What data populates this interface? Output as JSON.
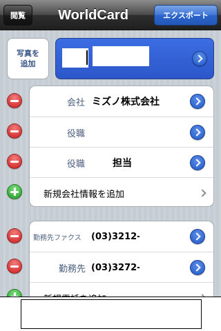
{
  "navbar": {
    "left_button": "閲覧",
    "title": "WorldCard",
    "right_button": "エクスポート"
  },
  "photo": {
    "label_line1": "写真を",
    "label_line2": "追加"
  },
  "company_section": {
    "rows": [
      {
        "label": "会社",
        "value": "ミズノ株式会社"
      },
      {
        "label": "役職",
        "value": ""
      },
      {
        "label": "役職",
        "value": "担当"
      }
    ],
    "add_label": "新規会社情報を追加"
  },
  "phone_section": {
    "rows": [
      {
        "label": "勤務先ファクス",
        "value": "(03)3212-"
      },
      {
        "label": "勤務先",
        "value": "(03)3272-"
      }
    ],
    "add_label": "新規電話を追加"
  },
  "colors": {
    "nav_accent": "#2b64cb",
    "delete": "#cc1b1b",
    "add": "#1f9a25",
    "disclosure": "#2058c9"
  }
}
